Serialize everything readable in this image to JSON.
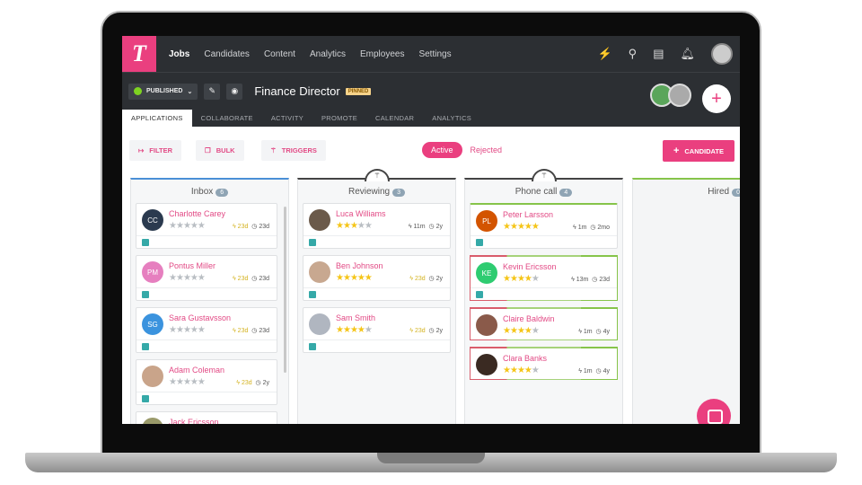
{
  "nav": {
    "logo": "T",
    "items": [
      "Jobs",
      "Candidates",
      "Content",
      "Analytics",
      "Employees",
      "Settings"
    ],
    "active": "Jobs"
  },
  "job": {
    "status": "PUBLISHED",
    "title": "Finance Director",
    "pinned": "PINNED"
  },
  "tabs": [
    "APPLICATIONS",
    "COLLABORATE",
    "ACTIVITY",
    "PROMOTE",
    "CALENDAR",
    "ANALYTICS"
  ],
  "toolbar": {
    "filter": "FILTER",
    "bulk": "BULK",
    "triggers": "TRIGGERS",
    "active": "Active",
    "rejected": "Rejected",
    "candidate": "CANDIDATE"
  },
  "colors": {
    "accent": "#ea3f7f",
    "nav": "#2c2f33",
    "star": "#f5c518"
  },
  "columns": [
    {
      "name": "Inbox",
      "count": "6",
      "cards": [
        {
          "name": "Charlotte Carey",
          "initials": "CC",
          "color": "#2b3a4f",
          "rating": 0,
          "activity": "23d",
          "age": "23d"
        },
        {
          "name": "Pontus Miller",
          "initials": "PM",
          "color": "#e67fbf",
          "rating": 0,
          "activity": "23d",
          "age": "23d"
        },
        {
          "name": "Sara Gustavsson",
          "initials": "SG",
          "color": "#3b93de",
          "rating": 0,
          "activity": "23d",
          "age": "23d"
        },
        {
          "name": "Adam Coleman",
          "initials": "",
          "color": "#c9a48a",
          "rating": 0,
          "activity": "23d",
          "age": "2y"
        },
        {
          "name": "Jack Ericsson",
          "initials": "",
          "color": "#9a9a6a",
          "rating": 0,
          "activity": "",
          "age": ""
        }
      ]
    },
    {
      "name": "Reviewing",
      "count": "3",
      "cards": [
        {
          "name": "Luca Williams",
          "initials": "",
          "color": "#6b5a4a",
          "rating": 3,
          "activity": "11m",
          "age": "2y"
        },
        {
          "name": "Ben Johnson",
          "initials": "",
          "color": "#c8a890",
          "rating": 5,
          "activity": "23d",
          "age": "2y"
        },
        {
          "name": "Sam Smith",
          "initials": "",
          "color": "#b0b6c0",
          "rating": 4,
          "activity": "23d",
          "age": "2y"
        }
      ]
    },
    {
      "name": "Phone call",
      "count": "4",
      "cards": [
        {
          "name": "Peter Larsson",
          "initials": "PL",
          "color": "#d35400",
          "rating": 4.5,
          "activity": "1m",
          "age": "2mo"
        },
        {
          "name": "Kevin Ericsson",
          "initials": "KE",
          "color": "#2ecc71",
          "rating": 4,
          "activity": "13m",
          "age": "23d"
        },
        {
          "name": "Claire Baldwin",
          "initials": "",
          "color": "#8a5a4a",
          "rating": 4,
          "activity": "1m",
          "age": "4y"
        },
        {
          "name": "Clara Banks",
          "initials": "",
          "color": "#3a2a22",
          "rating": 4,
          "activity": "1m",
          "age": "4y"
        }
      ]
    },
    {
      "name": "Hired",
      "count": "0",
      "cards": []
    }
  ]
}
